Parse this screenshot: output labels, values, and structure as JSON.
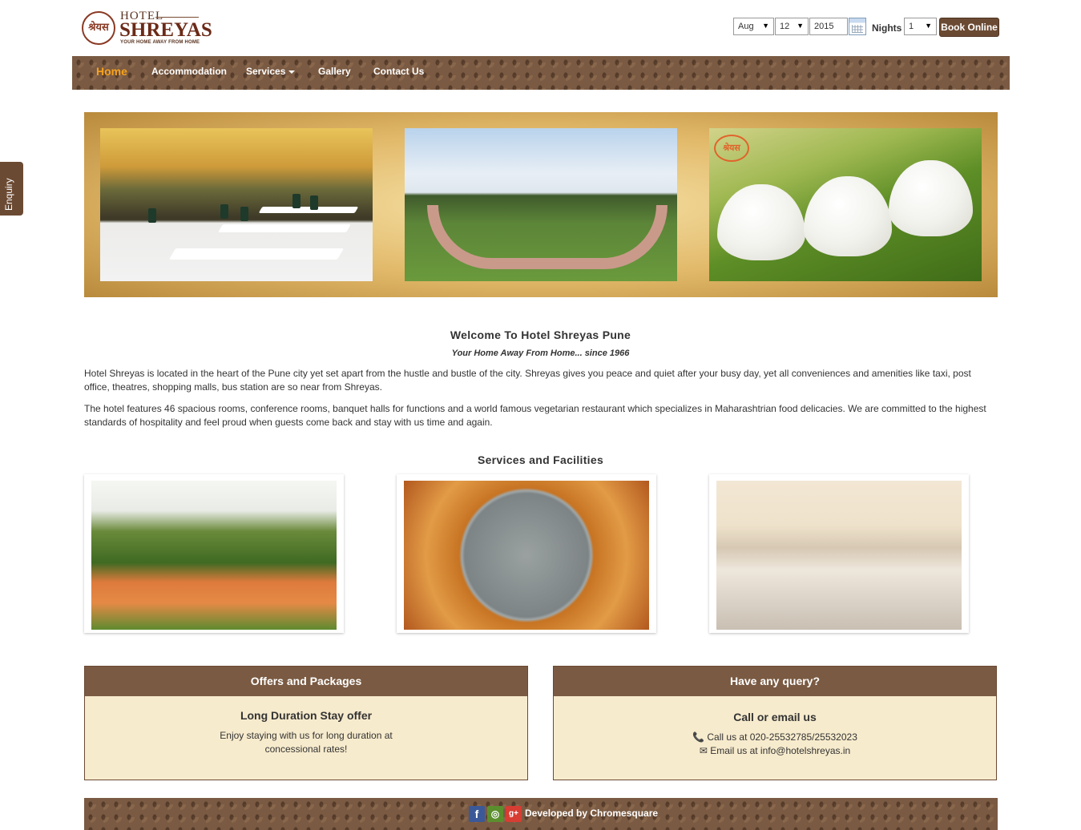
{
  "header": {
    "logo": {
      "hotel_word": "HOTEL",
      "name": "SHREYAS",
      "tagline": "YOUR HOME AWAY FROM HOME",
      "seal_text": "श्रेयस"
    },
    "booking": {
      "month": "Aug",
      "day": "12",
      "year": "2015",
      "nights_label": "Nights",
      "nights_value": "1",
      "book_button": "Book Online"
    }
  },
  "nav": {
    "items": [
      {
        "label": "Home",
        "active": true
      },
      {
        "label": "Accommodation"
      },
      {
        "label": "Services"
      },
      {
        "label": "Gallery"
      },
      {
        "label": "Contact Us"
      }
    ]
  },
  "enquiry_tab": "Enquiry",
  "banner": {
    "seal_text": "श्रेयस"
  },
  "welcome": {
    "title": "Welcome To Hotel Shreyas Pune",
    "subtitle": "Your Home Away From Home... since 1966",
    "para1": "Hotel Shreyas is located in the heart of the Pune city yet set apart from the hustle and bustle of the city. Shreyas gives you peace and quiet after your busy day, yet all conveniences and amenities like taxi, post office, theatres, shopping malls, bus station are so near from Shreyas.",
    "para2": "The hotel features 46 spacious rooms, conference rooms, banquet halls for functions and a world famous vegetarian restaurant which specializes in Maharashtrian food delicacies. We are committed to the highest standards of hospitality and feel proud when guests come back and stay with us time and again."
  },
  "services": {
    "title": "Services and Facilities"
  },
  "offers": {
    "heading": "Offers and Packages",
    "title": "Long Duration Stay offer",
    "line1": "Enjoy staying with us for long duration at",
    "line2": "concessional rates!"
  },
  "query": {
    "heading": "Have any query?",
    "title": "Call or email us",
    "phone": "Call us at 020-25532785/25532023",
    "email": "Email us at info@hotelshreyas.in"
  },
  "footer": {
    "developed_by": "Developed by Chromesquare",
    "social": [
      "facebook-icon",
      "tripadvisor-icon",
      "google-plus-icon"
    ]
  },
  "colors": {
    "brand_brown": "#7a5a42",
    "accent_orange": "#f7a21d",
    "panel_bg": "#f7ebcd"
  }
}
